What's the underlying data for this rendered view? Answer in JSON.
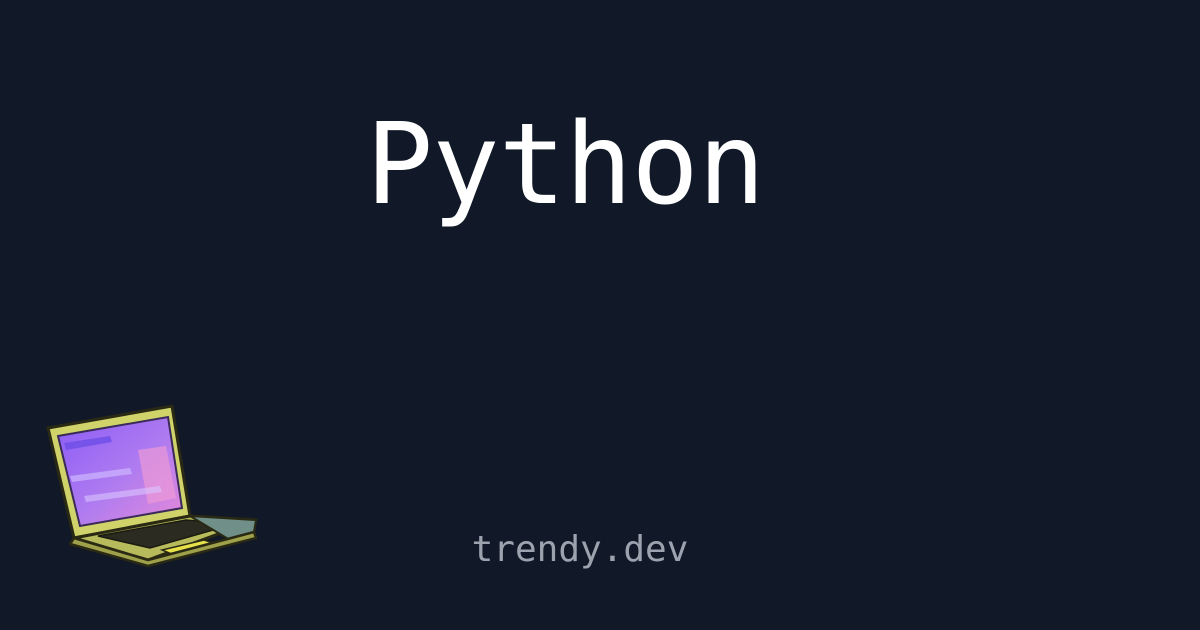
{
  "title": "Python",
  "site": "trendy.dev",
  "illustration": {
    "icon": "laptop-icon",
    "colors": {
      "background": "#111827",
      "title_text": "#ffffff",
      "site_text": "#9ca3af",
      "laptop_body": "#cfd36a",
      "laptop_outline": "#2a2a14",
      "screen_purple": "#9b5cf6",
      "screen_pink": "#e58ad8"
    }
  }
}
